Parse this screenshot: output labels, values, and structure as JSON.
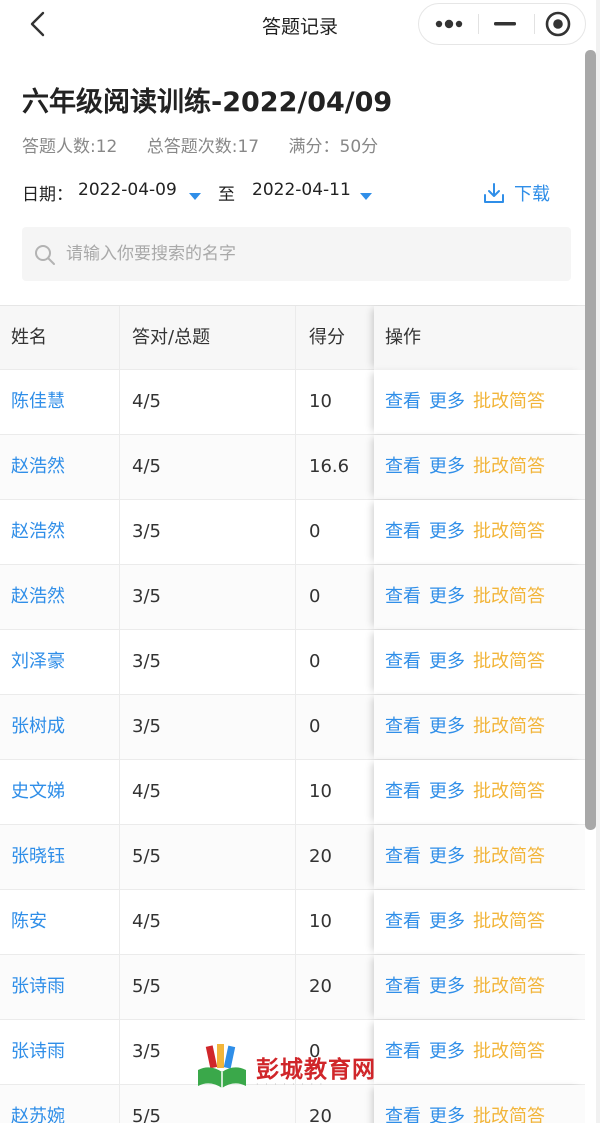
{
  "navbar": {
    "title": "答题记录"
  },
  "exam": {
    "title": "六年级阅读训练-2022/04/09",
    "stats": {
      "participants": "答题人数:12",
      "attempts": "总答题次数:17",
      "full_score": "满分：50分"
    }
  },
  "filters": {
    "date_label": "日期：",
    "start_date": "2022-04-09",
    "to_label": "至",
    "end_date": "2022-04-11",
    "download_label": "下载"
  },
  "search": {
    "placeholder": "请输入你要搜索的名字"
  },
  "table": {
    "headers": {
      "name": "姓名",
      "ratio": "答对/总题",
      "score": "得分",
      "actions": "操作"
    },
    "action_labels": {
      "view": "查看",
      "more": "更多",
      "grade": "批改简答"
    },
    "rows": [
      {
        "name": "陈佳慧",
        "ratio": "4/5",
        "score": "10"
      },
      {
        "name": "赵浩然",
        "ratio": "4/5",
        "score": "16.6"
      },
      {
        "name": "赵浩然",
        "ratio": "3/5",
        "score": "0"
      },
      {
        "name": "赵浩然",
        "ratio": "3/5",
        "score": "0"
      },
      {
        "name": "刘泽豪",
        "ratio": "3/5",
        "score": "0"
      },
      {
        "name": "张树成",
        "ratio": "3/5",
        "score": "0"
      },
      {
        "name": "史文娣",
        "ratio": "4/5",
        "score": "10"
      },
      {
        "name": "张晓钰",
        "ratio": "5/5",
        "score": "20"
      },
      {
        "name": "陈安",
        "ratio": "4/5",
        "score": "10"
      },
      {
        "name": "张诗雨",
        "ratio": "5/5",
        "score": "20"
      },
      {
        "name": "张诗雨",
        "ratio": "3/5",
        "score": "0"
      },
      {
        "name": "赵苏婉",
        "ratio": "5/5",
        "score": "20"
      }
    ]
  },
  "watermark": {
    "text": "彭城教育网"
  },
  "colors": {
    "link_blue": "#2f8ee8",
    "grade_orange": "#f2b53a",
    "watermark_red": "#d0262a"
  }
}
